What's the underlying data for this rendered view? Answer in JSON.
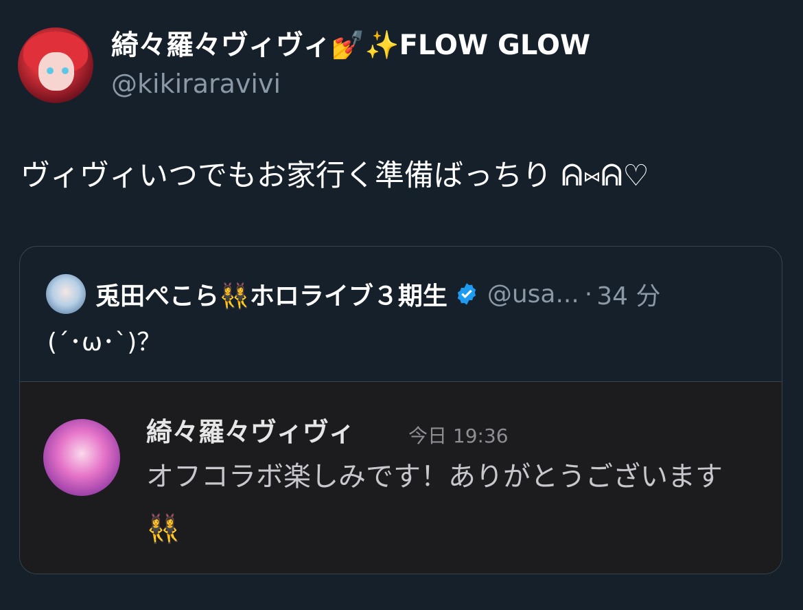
{
  "author": {
    "display_name": "綺々羅々ヴィヴィ💅✨FLOW GLOW",
    "handle": "@kikiraravivi"
  },
  "tweet": {
    "text": "ヴィヴィいつでもお家行く準備ばっちり ᕱ⑅ᕱ♡"
  },
  "quoted_tweet": {
    "display_name": "兎田ぺこら👯‍♀️ホロライブ３期生",
    "handle": "@usa...",
    "separator": "·",
    "time": "34 分",
    "text": "(´･ω･`)？",
    "verified_color": "#1d9bf0",
    "embedded_message": {
      "sender": "綺々羅々ヴィヴィ",
      "timestamp": "今日 19:36",
      "text": "オフコラボ楽しみです！ありがとうございます👯‍♀️"
    }
  }
}
